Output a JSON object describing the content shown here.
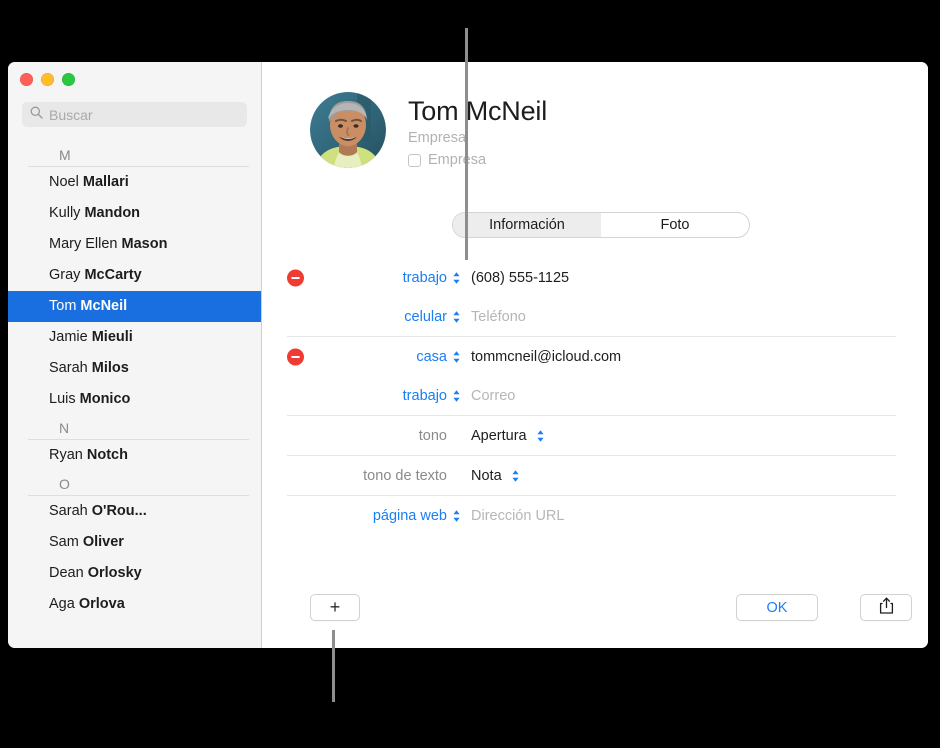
{
  "window": {
    "traffic_lights": [
      {
        "name": "close",
        "color": "#ff5f57"
      },
      {
        "name": "minimize",
        "color": "#febc2e"
      },
      {
        "name": "zoom",
        "color": "#28c840"
      }
    ]
  },
  "sidebar": {
    "search": {
      "placeholder": "Buscar",
      "value": "",
      "icon": "search-icon"
    },
    "sections": [
      {
        "letter": "M",
        "contacts": [
          {
            "first": "Noel ",
            "last": "Mallari",
            "selected": false
          },
          {
            "first": "Kully ",
            "last": "Mandon",
            "selected": false
          },
          {
            "first": "Mary Ellen ",
            "last": "Mason",
            "selected": false
          },
          {
            "first": "Gray ",
            "last": "McCarty",
            "selected": false
          },
          {
            "first": "Tom ",
            "last": "McNeil",
            "selected": true
          },
          {
            "first": "Jamie ",
            "last": "Mieuli",
            "selected": false
          },
          {
            "first": "Sarah ",
            "last": "Milos",
            "selected": false
          },
          {
            "first": "Luis ",
            "last": "Monico",
            "selected": false
          }
        ]
      },
      {
        "letter": "N",
        "contacts": [
          {
            "first": "Ryan ",
            "last": "Notch",
            "selected": false
          }
        ]
      },
      {
        "letter": "O",
        "contacts": [
          {
            "first": "Sarah ",
            "last": "O'Rou...",
            "selected": false
          },
          {
            "first": "Sam ",
            "last": "Oliver",
            "selected": false
          },
          {
            "first": "Dean ",
            "last": "Orlosky",
            "selected": false
          },
          {
            "first": "Aga ",
            "last": "Orlova",
            "selected": false
          }
        ]
      }
    ],
    "selected_color": "#1a6fe0"
  },
  "detail": {
    "avatar": "contact-photo",
    "name": "Tom McNeil",
    "company_placeholder": "Empresa",
    "company_checkbox_label": "Empresa",
    "company_checked": false,
    "tabs": [
      {
        "label": "Información",
        "active": true
      },
      {
        "label": "Foto",
        "active": false
      }
    ],
    "field_groups": [
      {
        "rows": [
          {
            "has_remove": true,
            "label": "trabajo",
            "label_style": "link",
            "label_stepper": true,
            "value": "(608) 555-1125",
            "is_placeholder": false,
            "value_stepper": false
          },
          {
            "has_remove": false,
            "label": "celular",
            "label_style": "link",
            "label_stepper": true,
            "value": "Teléfono",
            "is_placeholder": true,
            "value_stepper": false
          }
        ]
      },
      {
        "rows": [
          {
            "has_remove": true,
            "label": "casa",
            "label_style": "link",
            "label_stepper": true,
            "value": "tommcneil@icloud.com",
            "is_placeholder": false,
            "value_stepper": false
          },
          {
            "has_remove": false,
            "label": "trabajo",
            "label_style": "link",
            "label_stepper": true,
            "value": "Correo",
            "is_placeholder": true,
            "value_stepper": false
          }
        ]
      },
      {
        "rows": [
          {
            "has_remove": false,
            "label": "tono",
            "label_style": "plain",
            "label_stepper": false,
            "value": "Apertura",
            "is_placeholder": false,
            "value_stepper": true
          }
        ]
      },
      {
        "rows": [
          {
            "has_remove": false,
            "label": "tono de texto",
            "label_style": "plain",
            "label_stepper": false,
            "value": "Nota",
            "is_placeholder": false,
            "value_stepper": true
          }
        ]
      },
      {
        "rows": [
          {
            "has_remove": false,
            "label": "página web",
            "label_style": "link",
            "label_stepper": true,
            "value": "Dirección URL",
            "is_placeholder": true,
            "value_stepper": false
          }
        ]
      }
    ]
  },
  "bottom_bar": {
    "add_label": "+",
    "ok_label": "OK",
    "share_icon": "share-icon"
  },
  "colors": {
    "accent_blue": "#1a7ef5",
    "selection_blue": "#1a6fe0",
    "remove_red": "#ee3b33",
    "placeholder_gray": "#b6b6b6"
  }
}
